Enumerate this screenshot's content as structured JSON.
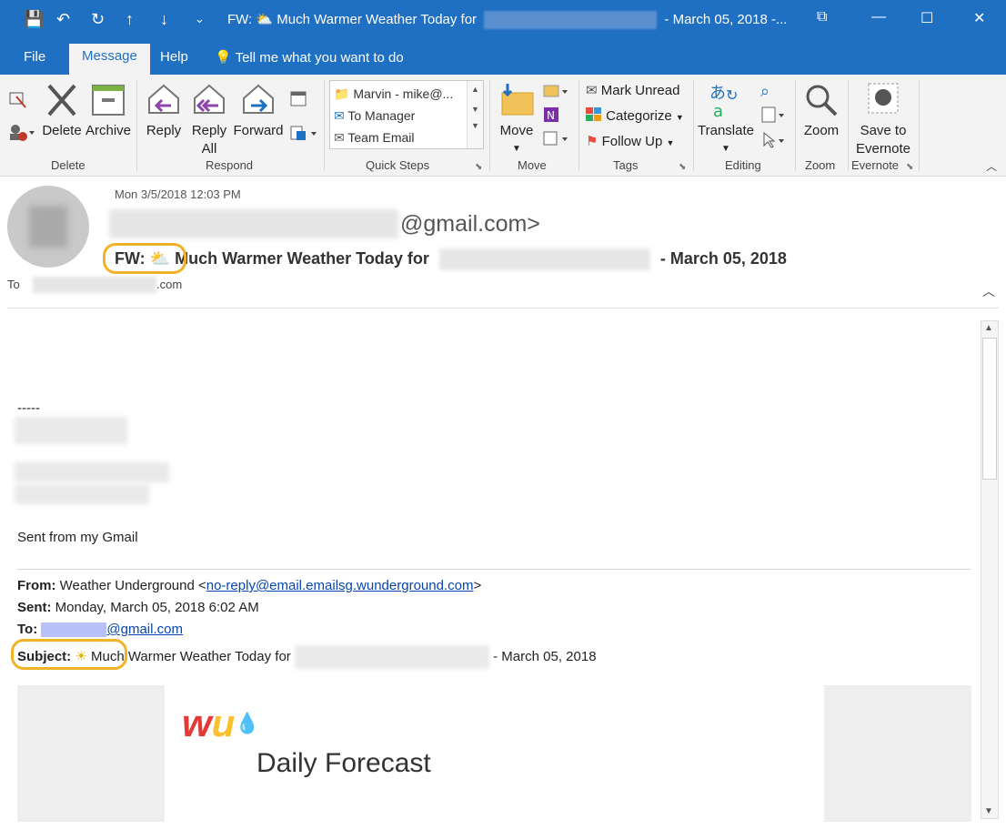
{
  "window": {
    "title_prefix": "FW:",
    "title_main": "Much Warmer Weather Today for",
    "title_suffix": "- March 05, 2018  -..."
  },
  "quick_access": {
    "save": "💾",
    "undo": "↶",
    "redo": "↻",
    "up": "↑",
    "down": "↓",
    "more": "⌄"
  },
  "window_controls": {
    "restore_icon": "⧉",
    "minimize": "—",
    "maximize": "☐",
    "close": "✕"
  },
  "menu": {
    "tabs": [
      "File",
      "Message",
      "Help"
    ],
    "tell_me": "Tell me what you want to do"
  },
  "ribbon": {
    "delete": {
      "delete_label": "Delete",
      "archive_label": "Archive",
      "group": "Delete"
    },
    "respond": {
      "reply": "Reply",
      "reply_all_1": "Reply",
      "reply_all_2": "All",
      "forward": "Forward",
      "group": "Respond"
    },
    "quick_steps": {
      "items": [
        "Marvin - mike@...",
        "To Manager",
        "Team Email"
      ],
      "group": "Quick Steps"
    },
    "move": {
      "move_label": "Move",
      "group": "Move"
    },
    "tags": {
      "mark_unread": "Mark Unread",
      "categorize": "Categorize",
      "follow_up": "Follow Up",
      "group": "Tags"
    },
    "editing": {
      "translate": "Translate",
      "group": "Editing"
    },
    "zoom": {
      "zoom_label": "Zoom",
      "group": "Zoom"
    },
    "evernote": {
      "save_1": "Save to",
      "save_2": "Evernote",
      "group": "Evernote"
    }
  },
  "header": {
    "date": "Mon 3/5/2018 12:03 PM",
    "from_domain": "@gmail.com>",
    "subject_prefix": "FW:",
    "subject_main": "Much Warmer Weather Today for",
    "subject_suffix": "- March 05, 2018",
    "to_label": "To",
    "to_domain": ".com"
  },
  "body": {
    "dashes": "-----",
    "sent_from": "Sent from my Gmail",
    "fwd": {
      "from_label": "From:",
      "from_name": "Weather Underground <",
      "from_email": "no-reply@email.emailsg.wunderground.com",
      "from_close": ">",
      "sent_label": "Sent:",
      "sent_value": "Monday, March 05, 2018 6:02 AM",
      "to_label": "To:",
      "to_email_domain": "@gmail.com",
      "subject_label": "Subject:",
      "subject_main": "Much Warmer Weather Today for",
      "subject_suffix": "- March 05, 2018"
    },
    "banner": {
      "logo_w": "w",
      "logo_u": "u",
      "title": "Daily Forecast"
    }
  },
  "colors": {
    "brand": "#1f6fc3",
    "highlight_ring": "#f0b227",
    "link": "#0645ad"
  }
}
